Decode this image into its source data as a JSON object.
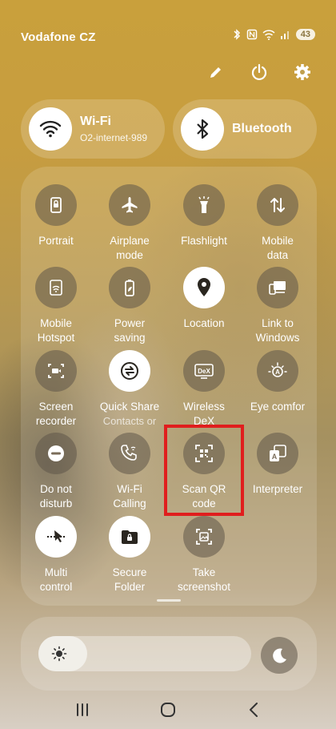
{
  "status": {
    "carrier": "Vodafone CZ",
    "battery": "43"
  },
  "quick_toggles": {
    "wifi": {
      "title": "Wi-Fi",
      "subtitle": "O2-internet-989"
    },
    "bluetooth": {
      "title": "Bluetooth"
    }
  },
  "tiles": [
    {
      "label": "Portrait",
      "icon": "rotation-lock-icon",
      "active": false
    },
    {
      "label": "Airplane\nmode",
      "icon": "airplane-icon",
      "active": false
    },
    {
      "label": "Flashlight",
      "icon": "flashlight-icon",
      "active": false
    },
    {
      "label": "Mobile\ndata",
      "icon": "mobile-data-icon",
      "active": false
    },
    {
      "label": "Mobile\nHotspot",
      "icon": "hotspot-icon",
      "active": false
    },
    {
      "label": "Power\nsaving",
      "icon": "battery-leaf-icon",
      "active": false
    },
    {
      "label": "Location",
      "icon": "location-icon",
      "active": true
    },
    {
      "label": "Link to\nWindows",
      "icon": "link-to-windows-icon",
      "active": false
    },
    {
      "label": "Screen\nrecorder",
      "icon": "screen-recorder-icon",
      "active": false
    },
    {
      "label": "Quick Share",
      "sub": "Contacts or",
      "icon": "quick-share-icon",
      "active": true
    },
    {
      "label": "Wireless\nDeX",
      "icon": "dex-icon",
      "active": false
    },
    {
      "label": "Eye comfor",
      "icon": "eye-comfort-icon",
      "active": false
    },
    {
      "label": "Do not\ndisturb",
      "icon": "do-not-disturb-icon",
      "active": false
    },
    {
      "label": "Wi-Fi\nCalling",
      "icon": "wifi-calling-icon",
      "active": false
    },
    {
      "label": "Scan QR\ncode",
      "icon": "qr-scan-icon",
      "active": false
    },
    {
      "label": "Interpreter",
      "icon": "interpreter-icon",
      "active": false
    },
    {
      "label": "Multi\ncontrol",
      "icon": "multi-control-icon",
      "active": true
    },
    {
      "label": "Secure\nFolder",
      "icon": "secure-folder-icon",
      "active": true
    },
    {
      "label": "Take\nscreenshot",
      "icon": "screenshot-icon",
      "active": false
    }
  ],
  "brightness": {
    "level_percent": 23
  },
  "colors": {
    "highlight": "#e01e1e",
    "tile_off": "#5f5548",
    "tile_on": "#ffffff"
  }
}
